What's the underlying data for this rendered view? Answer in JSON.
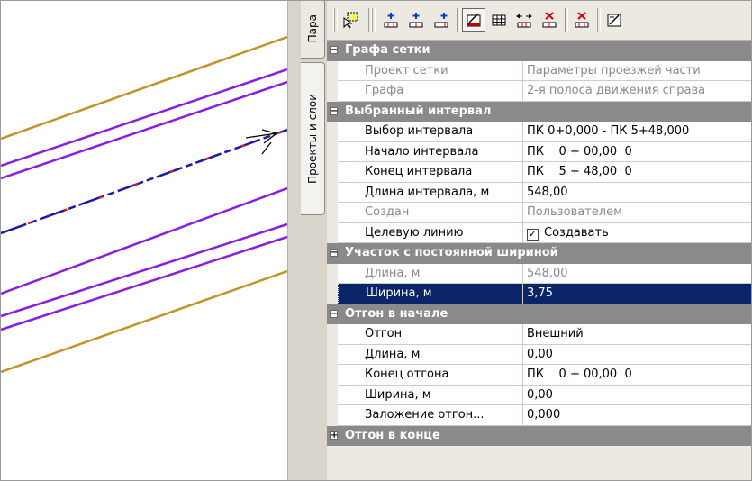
{
  "tabs": {
    "parameters": "Пара",
    "projects_layers": "Проекты и слои"
  },
  "colors": {
    "category_bg": "#8a8a8a",
    "selection_bg": "#0a246a",
    "line_gold": "#c09428",
    "line_purple": "#8a1ee0",
    "line_blue": "#1a1aa8",
    "line_red": "#d02020"
  },
  "toolbar": {
    "icons": [
      "select-region-icon",
      "add-point-icon",
      "add-interval-icon",
      "add-interval-right-icon",
      "properties-icon",
      "table-icon",
      "width-icon",
      "delete-icon",
      "delete-interval-icon",
      "settings-icon"
    ]
  },
  "grid": {
    "cat_grafa": "Графа сетки",
    "project_k": "Проект сетки",
    "project_v": "Параметры проезжей части",
    "grafa_k": "Графа",
    "grafa_v": "2-я полоса движения справа",
    "cat_interval": "Выбранный интервал",
    "choice_k": "Выбор интервала",
    "choice_v": "ПК 0+0,000 - ПК 5+48,000",
    "start_k": "Начало интервала",
    "start_v": "ПК    0 + 00,00  0",
    "end_k": "Конец интервала",
    "end_v": "ПК    5 + 48,00  0",
    "len_k": "Длина интервала, м",
    "len_v": "548,00",
    "created_k": "Создан",
    "created_v": "Пользователем",
    "target_k": "Целевую линию",
    "target_v": "Создавать",
    "cat_const": "Участок с постоянной шириной",
    "clen_k": "Длина, м",
    "clen_v": "548,00",
    "cwidth_k": "Ширина, м",
    "cwidth_v": "3,75",
    "cat_start": "Отгон в начале",
    "otgon_k": "Отгон",
    "otgon_v": "Внешний",
    "slen_k": "Длина, м",
    "slen_v": "0,00",
    "send_k": "Конец отгона",
    "send_v": "ПК    0 + 00,00  0",
    "swidth_k": "Ширина, м",
    "swidth_v": "0,00",
    "slope_k": "Заложение отгон...",
    "slope_v": "0,000",
    "cat_end": "Отгон в конце"
  }
}
